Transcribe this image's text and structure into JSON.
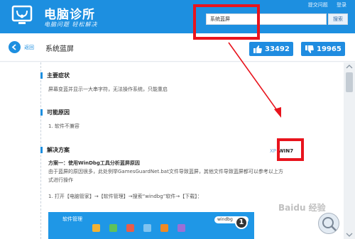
{
  "header": {
    "app_title": "电脑诊所",
    "app_subtitle": "电脑问题 轻松解决",
    "links": [
      "提交问题",
      "登录"
    ],
    "search": {
      "value": "系统蓝屏",
      "button_label": "搜索"
    }
  },
  "titlebar": {
    "back_label": "返回",
    "page_title": "系统蓝屏",
    "upvotes": "33492",
    "downvotes": "19965"
  },
  "sections": {
    "symptoms": {
      "heading": "主要症状",
      "text": "屏幕变蓝并显示一大串字符，无法操作系统，只能重启"
    },
    "causes": {
      "heading": "可能原因",
      "text": "1. 软件不兼容"
    },
    "solution": {
      "heading": "解决方案",
      "os_tabs": {
        "xp": "XP",
        "win7": "WIN7"
      },
      "plan_title": "方案一：使用WinDbg工具分析蓝屏原因",
      "plan_text_1": "由于蓝屏的原因很多，此处例举GamesGuardNet.bat文件导致蓝屏，其他文件导致蓝屏都可以参考以上方",
      "plan_text_2": "式进行操作",
      "step_1": "1. 打开【电脑管家】→【软件管理】→搜索“windbg”软件→【下载】："
    }
  },
  "thumbnail": {
    "title": "软件管理",
    "search_text": "windbg",
    "step_badge": "1"
  },
  "watermark": "Baidu 经验",
  "colors": {
    "header_blue": "#1d8fe0",
    "annotation_red": "#e8141d",
    "vote_blue": "#1f8ce0"
  }
}
